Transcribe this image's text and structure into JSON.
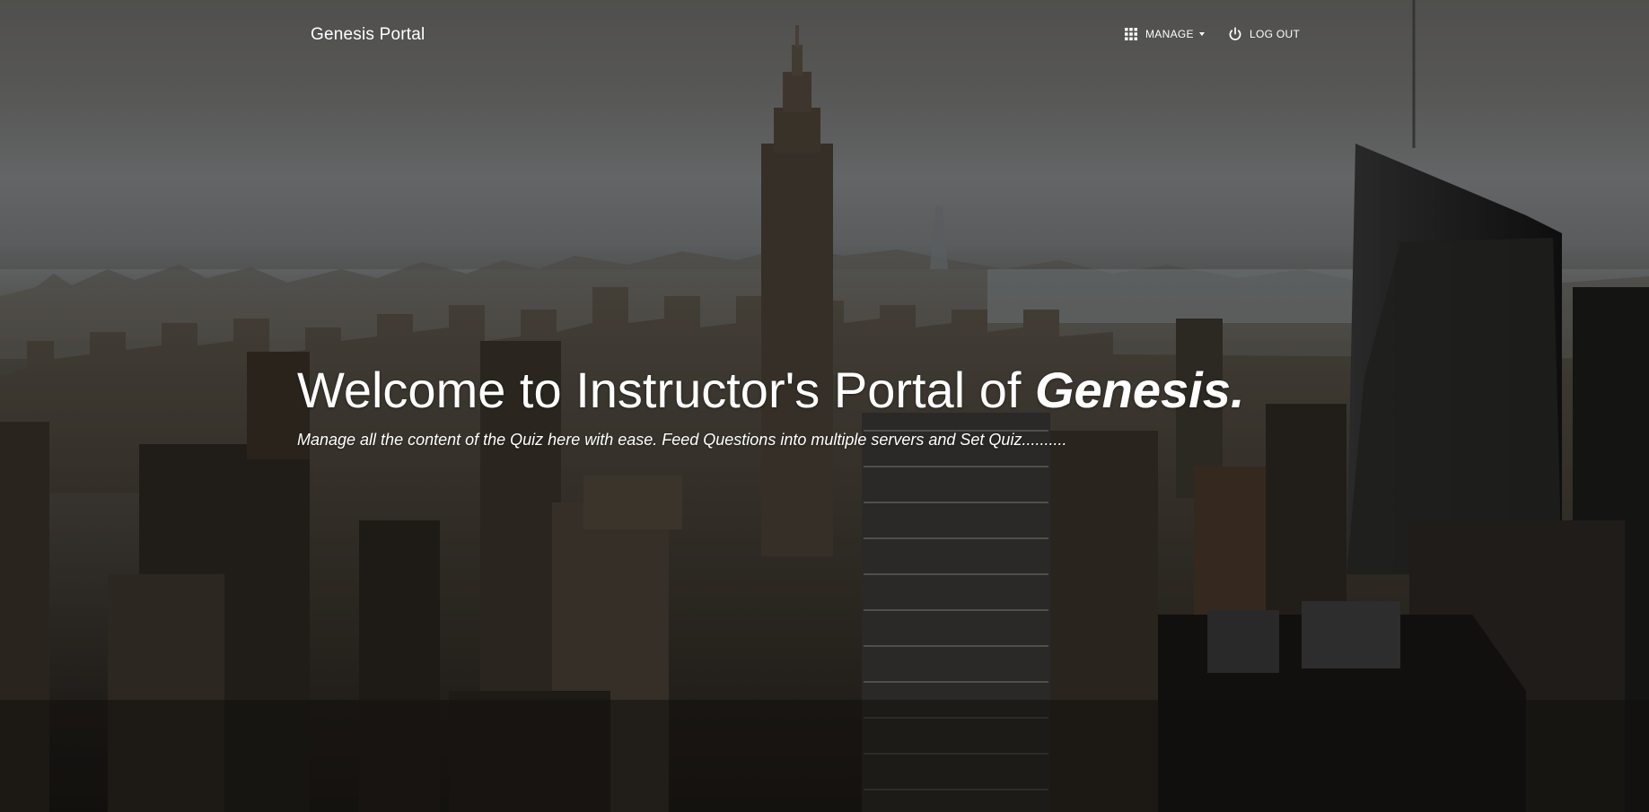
{
  "navbar": {
    "brand": "Genesis Portal",
    "manage": {
      "icon": "apps-grid-icon",
      "label": "MANAGE"
    },
    "logout": {
      "icon": "power-icon",
      "label": "LOG OUT"
    }
  },
  "hero": {
    "title_prefix": "Welcome to Instructor's Portal of",
    "title_emphasis": "Genesis.",
    "subtitle": "Manage all the content of the Quiz here with ease. Feed Questions into multiple servers and Set Quiz.........."
  },
  "colors": {
    "text": "#ffffff",
    "overlay": "rgba(0,0,0,0.28)"
  }
}
